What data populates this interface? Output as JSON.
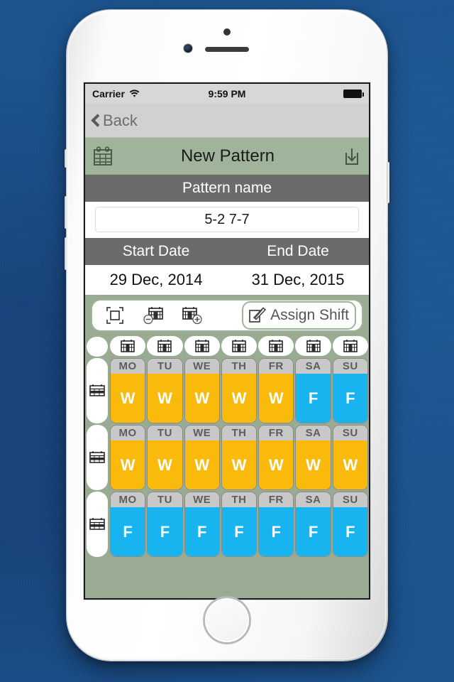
{
  "status_bar": {
    "carrier": "Carrier",
    "wifi_icon": "wifi-icon",
    "time": "9:59 PM",
    "battery_icon": "battery-full-icon"
  },
  "nav_bar": {
    "back_label": "Back",
    "back_icon": "chevron-left-icon"
  },
  "title_bar": {
    "title": "New Pattern",
    "left_icon": "calendar-icon",
    "right_icon": "save-download-icon",
    "background_color": "#9fb49a"
  },
  "pattern_name": {
    "label": "Pattern name",
    "value": "5-2 7-7",
    "placeholder": "Pattern name"
  },
  "dates": {
    "start_label": "Start Date",
    "end_label": "End Date",
    "start_value": "29 Dec, 2014",
    "end_value": "31 Dec, 2015"
  },
  "toolbar": {
    "select_all_icon": "select-frame-icon",
    "remove_week_icon": "calendar-minus-icon",
    "add_week_icon": "calendar-plus-icon",
    "assign_shift_label": "Assign Shift",
    "assign_shift_icon": "pencil-edit-icon",
    "accent_color": "#9fb49a"
  },
  "grid": {
    "day_labels": [
      "MO",
      "TU",
      "WE",
      "TH",
      "FR",
      "SA",
      "SU"
    ],
    "column_header_icon": "calendar-column-icon",
    "row_header_icon": "calendar-row-icon",
    "shift_colors": {
      "W": "#f9ba0c",
      "F": "#18b4ef",
      "empty": "#ffffff"
    },
    "weeks": [
      {
        "row_icon": "calendar-row-icon",
        "shifts": [
          "W",
          "W",
          "W",
          "W",
          "W",
          "F",
          "F"
        ]
      },
      {
        "row_icon": "calendar-row-icon",
        "shifts": [
          "W",
          "W",
          "W",
          "W",
          "W",
          "W",
          "W"
        ]
      },
      {
        "row_icon": "calendar-row-icon",
        "shifts": [
          "F",
          "F",
          "F",
          "F",
          "F",
          "F",
          "F"
        ]
      }
    ]
  },
  "colors": {
    "backdrop": "#1d5490",
    "screen_background": "#9aab93",
    "strip_gray": "#6b6b6b",
    "day_header_gray": "#c8c8c8"
  }
}
